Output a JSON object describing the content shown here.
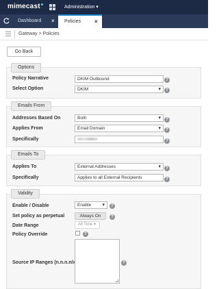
{
  "topbar": {
    "logo": "mimecast",
    "menu_label": "Administration ▾"
  },
  "tabs": [
    {
      "label": "Dashboard",
      "close": "×"
    },
    {
      "label": "Policies",
      "close": "×"
    }
  ],
  "breadcrumb": "Gateway  >  Policies",
  "go_back_label": "Go Back",
  "help_glyph": "?",
  "sections": {
    "options": {
      "title": "Options",
      "policy_narrative_label": "Policy Narrative",
      "policy_narrative_value": "DKIM Outbound",
      "select_option_label": "Select Option",
      "select_option_value": "DKIM"
    },
    "emails_from": {
      "title": "Emails From",
      "addresses_based_on_label": "Addresses Based On",
      "addresses_based_on_value": "Both",
      "applies_from_label": "Applies From",
      "applies_from_value": "Email Domain",
      "specifically_label": "Specifically"
    },
    "emails_to": {
      "title": "Emails To",
      "applies_to_label": "Applies To",
      "applies_to_value": "External Addresses",
      "specifically_label": "Specifically",
      "specifically_value": "Applies to all External Recipients"
    },
    "validity": {
      "title": "Validity",
      "enable_disable_label": "Enable / Disable",
      "enable_disable_value": "Enable",
      "perpetual_label": "Set policy as perpetual",
      "perpetual_button": "Always On",
      "date_range_label": "Date Range",
      "date_range_value": "All Time",
      "policy_override_label": "Policy Override",
      "source_ip_label": "Source IP Ranges (n.n.n.n/x)"
    }
  },
  "colors": {
    "topbar": "#1c2a45",
    "tabbar": "#2a3a58",
    "active_tab_accent": "#1e88c8"
  }
}
